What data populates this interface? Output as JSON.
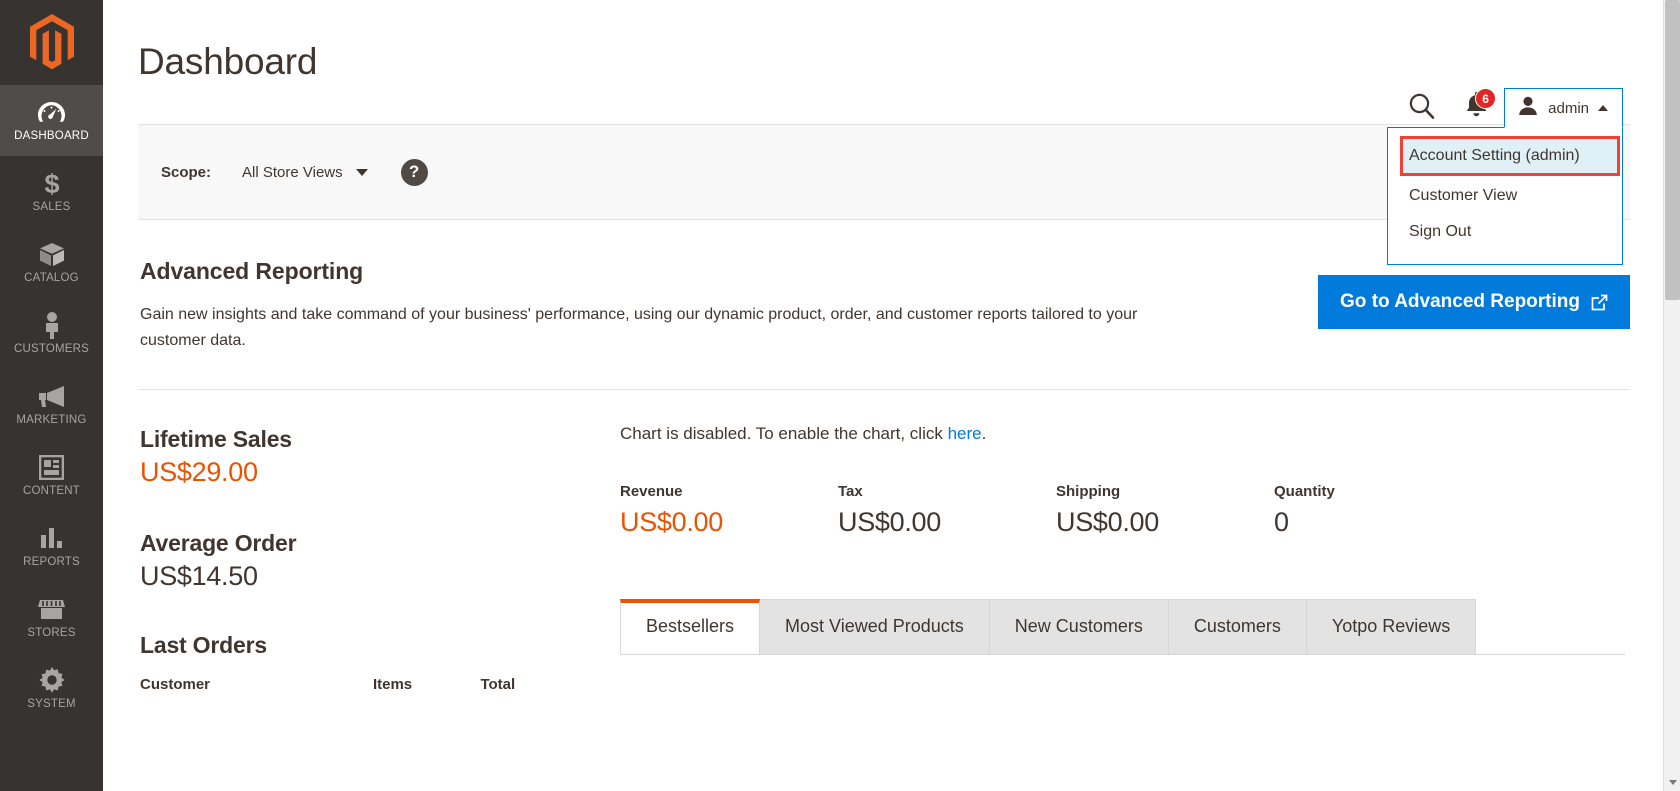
{
  "sidebar": {
    "logo_name": "magento-logo",
    "items": [
      {
        "label": "DASHBOARD",
        "icon": "dashboard-gauge-icon",
        "active": true
      },
      {
        "label": "SALES",
        "icon": "dollar-sign-icon",
        "active": false
      },
      {
        "label": "CATALOG",
        "icon": "box-icon",
        "active": false
      },
      {
        "label": "CUSTOMERS",
        "icon": "person-icon",
        "active": false
      },
      {
        "label": "MARKETING",
        "icon": "megaphone-icon",
        "active": false
      },
      {
        "label": "CONTENT",
        "icon": "layout-page-icon",
        "active": false
      },
      {
        "label": "REPORTS",
        "icon": "bar-chart-icon",
        "active": false
      },
      {
        "label": "STORES",
        "icon": "storefront-icon",
        "active": false
      },
      {
        "label": "SYSTEM",
        "icon": "gear-icon",
        "active": false
      }
    ]
  },
  "header": {
    "title": "Dashboard",
    "search_icon": "search-icon",
    "notifications": {
      "icon": "bell-icon",
      "count": "6"
    },
    "admin": {
      "avatar_icon": "user-avatar-icon",
      "name": "admin",
      "caret_icon": "chevron-up-icon",
      "menu": [
        {
          "label": "Account Setting (admin)",
          "highlighted": true
        },
        {
          "label": "Customer View",
          "highlighted": false
        },
        {
          "label": "Sign Out",
          "highlighted": false
        }
      ]
    }
  },
  "scope": {
    "label": "Scope:",
    "value": "All Store Views",
    "caret_icon": "chevron-down-icon",
    "help_icon": "question-mark-icon",
    "help_glyph": "?"
  },
  "advanced_reporting": {
    "title": "Advanced Reporting",
    "description": "Gain new insights and take command of your business' performance, using our dynamic product, order, and customer reports tailored to your customer data.",
    "button_label": "Go to Advanced Reporting",
    "button_icon": "external-link-icon",
    "button_color": "#007bdb"
  },
  "stats": {
    "lifetime_sales": {
      "label": "Lifetime Sales",
      "value": "US$29.00",
      "accent": "#eb5202"
    },
    "average_order": {
      "label": "Average Order",
      "value": "US$14.50"
    }
  },
  "last_orders": {
    "title": "Last Orders",
    "columns": [
      "Customer",
      "Items",
      "Total"
    ],
    "rows": []
  },
  "chart": {
    "message_prefix": "Chart is disabled. To enable the chart, click ",
    "link_text": "here",
    "message_suffix": ".",
    "link_color": "#007bdb"
  },
  "totals": [
    {
      "label": "Revenue",
      "value": "US$0.00",
      "accent": true
    },
    {
      "label": "Tax",
      "value": "US$0.00",
      "accent": false
    },
    {
      "label": "Shipping",
      "value": "US$0.00",
      "accent": false
    },
    {
      "label": "Quantity",
      "value": "0",
      "accent": false
    }
  ],
  "tabs": [
    {
      "label": "Bestsellers",
      "active": true
    },
    {
      "label": "Most Viewed Products",
      "active": false
    },
    {
      "label": "New Customers",
      "active": false
    },
    {
      "label": "Customers",
      "active": false
    },
    {
      "label": "Yotpo Reviews",
      "active": false
    }
  ],
  "colors": {
    "brand_orange": "#eb5202",
    "accent_blue": "#007bdb",
    "sidebar_bg": "#373330",
    "highlight_red": "#ef4136",
    "highlight_fill": "#e0f0f7"
  }
}
